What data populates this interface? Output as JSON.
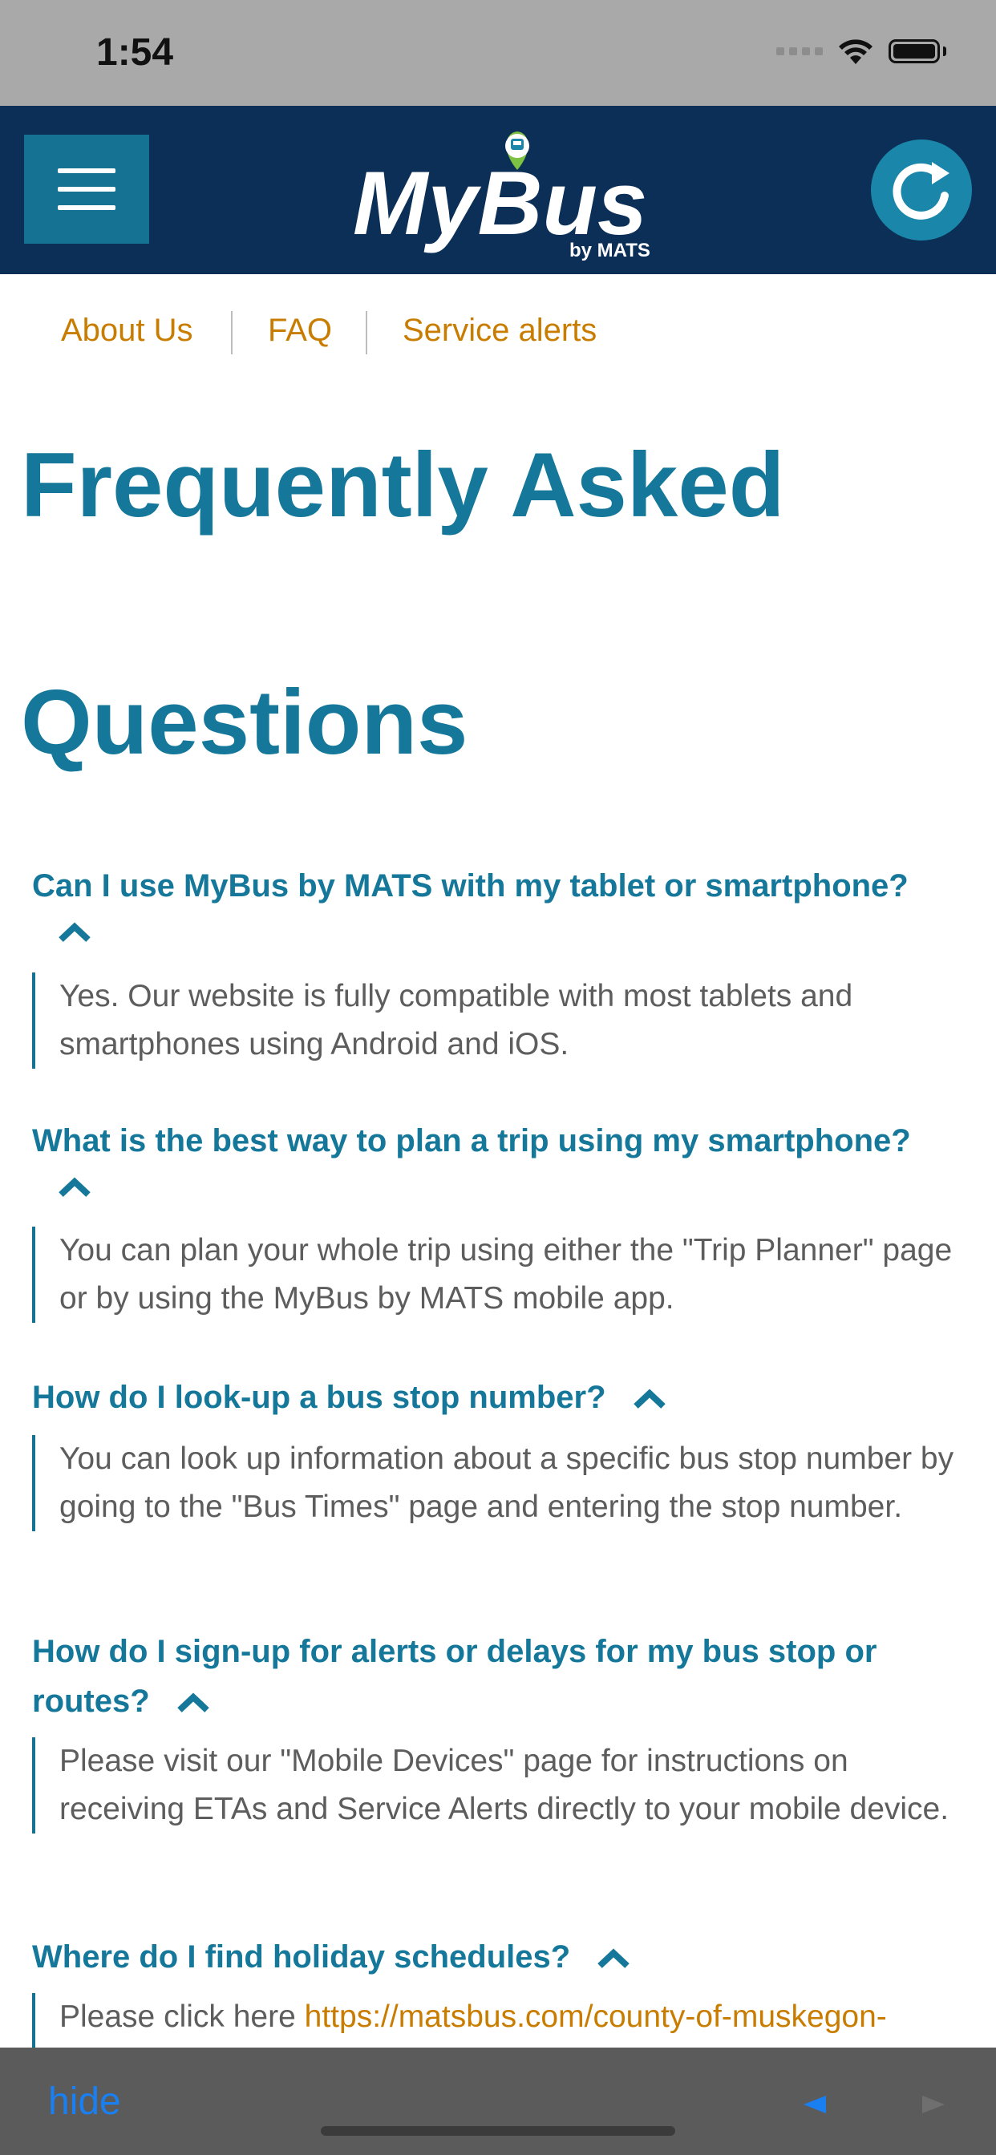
{
  "status_bar": {
    "time": "1:54"
  },
  "header": {
    "logo_main": "MyBus",
    "logo_sub": "by MATS",
    "menu_icon": "hamburger-menu-icon",
    "refresh_icon": "refresh-icon",
    "colors": {
      "background": "#0b2f57",
      "menu_button": "#157292",
      "refresh_button": "#1a87aa",
      "pin": "#7dc242"
    }
  },
  "top_links": [
    "About Us",
    "FAQ",
    "Service alerts"
  ],
  "page_title_line1": "Frequently Asked",
  "page_title_line2": "Questions",
  "faqs": [
    {
      "question": "Can I use MyBus by MATS with my tablet or smartphone?",
      "answer": "Yes. Our website is fully compatible with most tablets and smartphones using Android and iOS."
    },
    {
      "question": "What is the best way to plan a trip using my smartphone?",
      "answer": "You can plan your whole trip using either the \"Trip Planner\" page or by using the MyBus by MATS mobile app."
    },
    {
      "question": "How do I look-up a bus stop number?",
      "answer": "You can look up information about a specific bus stop number by going to the \"Bus Times\" page and entering the stop number."
    },
    {
      "question": "How do I sign-up for alerts or delays for my bus stop or routes?",
      "answer": "Please visit our \"Mobile Devices\" page for instructions on receiving ETAs and Service Alerts directly to your mobile device."
    },
    {
      "question": "Where do I find holiday schedules?",
      "answer_prefix": "Please click here ",
      "answer_link": "https://matsbus.com/county-of-muskegon-"
    }
  ],
  "bottom_bar": {
    "hide_label": "hide",
    "back_icon": "back-arrow-icon",
    "forward_icon": "forward-arrow-icon"
  },
  "accent_colors": {
    "heading": "#15789a",
    "link": "#c97d00",
    "answer_text": "#5d5d5d"
  }
}
